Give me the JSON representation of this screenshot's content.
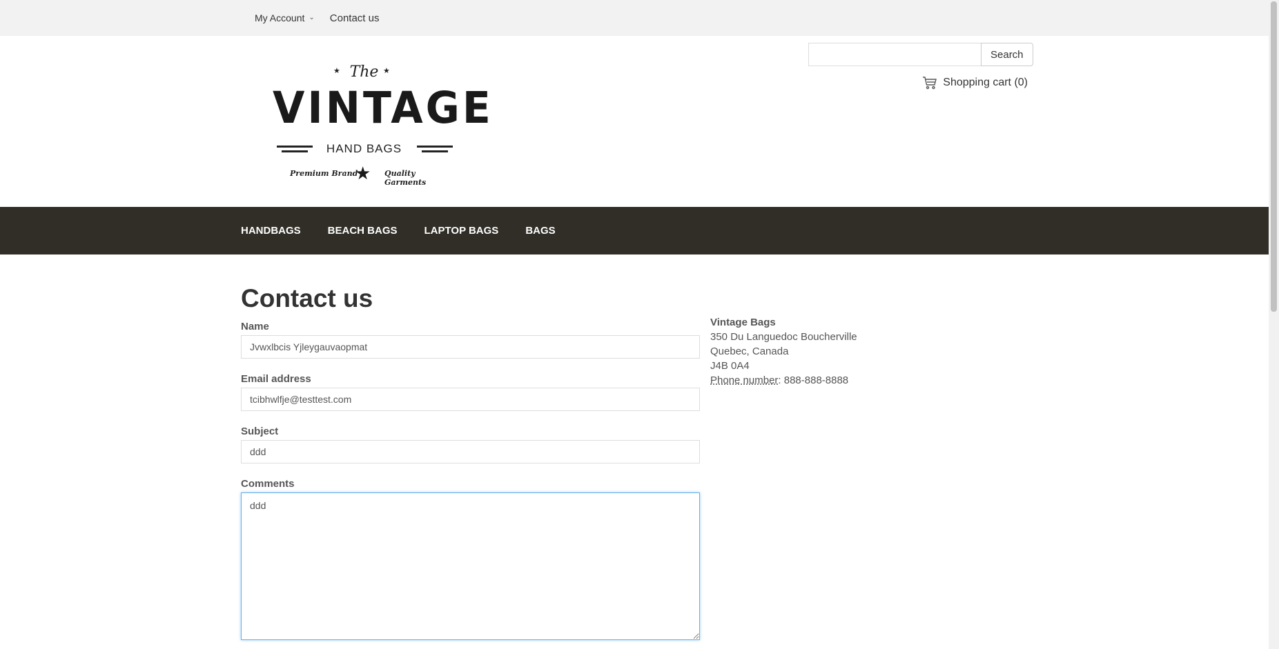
{
  "topbar": {
    "my_account": "My Account",
    "contact_us": "Contact us"
  },
  "search": {
    "value": "",
    "button": "Search"
  },
  "cart": {
    "label": "Shopping cart (0)"
  },
  "logo": {
    "the": "The",
    "vintage": "VINTAGE",
    "hand_bags": "HAND BAGS",
    "tag_left": "Premium Brand",
    "tag_right": "Quality Garments"
  },
  "nav": {
    "items": [
      "HANDBAGS",
      "BEACH BAGS",
      "LAPTOP BAGS",
      "BAGS"
    ]
  },
  "page": {
    "title": "Contact us"
  },
  "form": {
    "name_label": "Name",
    "name_value": "Jvwxlbcis Yjleygauvaopmat",
    "email_label": "Email address",
    "email_value": "tcibhwlfje@testtest.com",
    "subject_label": "Subject",
    "subject_value": "ddd",
    "comments_label": "Comments",
    "comments_value": "ddd"
  },
  "address": {
    "store": "Vintage Bags",
    "line1": "350 Du Languedoc Boucherville",
    "line2": "Quebec, Canada",
    "line3": "J4B 0A4",
    "phone_label": "Phone number",
    "phone_value": ": 888-888-8888"
  }
}
